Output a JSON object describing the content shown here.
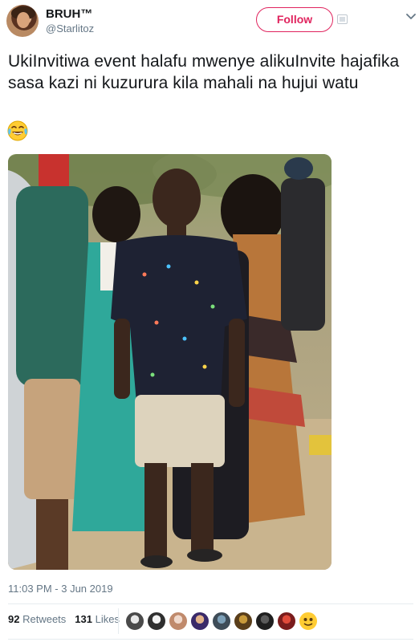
{
  "user": {
    "display_name": "BRUH™",
    "handle": "@Starlitoz"
  },
  "follow_button": {
    "label": "Follow"
  },
  "tweet": {
    "text": "UkiInvitiwa event halafu mwenye alikuInvite hajafika sasa kazi ni kuzurura kila mahali na hujui watu",
    "emoji": "face-with-tears-of-joy",
    "timestamp": "11:03 PM - 3 Jun 2019"
  },
  "stats": {
    "retweets_count": "92",
    "retweets_label": "Retweets",
    "likes_count": "131",
    "likes_label": "Likes"
  },
  "likers": [
    {
      "icon": "avatar-1"
    },
    {
      "icon": "avatar-2"
    },
    {
      "icon": "avatar-3"
    },
    {
      "icon": "avatar-4"
    },
    {
      "icon": "avatar-5"
    },
    {
      "icon": "avatar-6"
    },
    {
      "icon": "avatar-7"
    },
    {
      "icon": "avatar-8"
    },
    {
      "icon": "avatar-9"
    }
  ],
  "colors": {
    "follow_accent": "#e0245e",
    "secondary_text": "#657786",
    "primary_text": "#14171a"
  }
}
